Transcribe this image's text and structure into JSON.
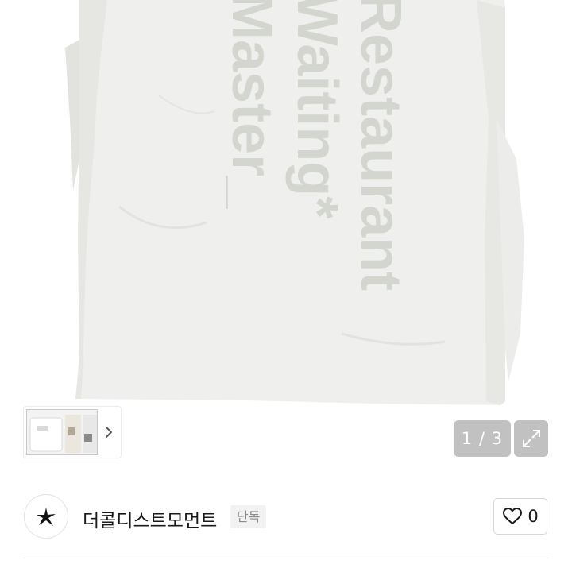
{
  "gallery": {
    "product_image": "white-tshirt-photo",
    "print_lines": [
      "Restaurant",
      "Waiting*",
      "Master_"
    ],
    "thumbnail_image": "product-thumbnails",
    "next_icon": "chevron-right-icon",
    "page_indicator": "1 / 3",
    "fullscreen_icon": "expand-icon"
  },
  "seller": {
    "avatar_icon": "star-logo-icon",
    "shop_name": "더콜디스트모먼트",
    "badge": "단독",
    "like_icon": "heart-outline-icon",
    "like_count": "0"
  },
  "colors": {
    "background": "#ffffff",
    "shirt": "#efefed",
    "print": "#d3d5cf",
    "overlay": "#a0a0a0"
  }
}
